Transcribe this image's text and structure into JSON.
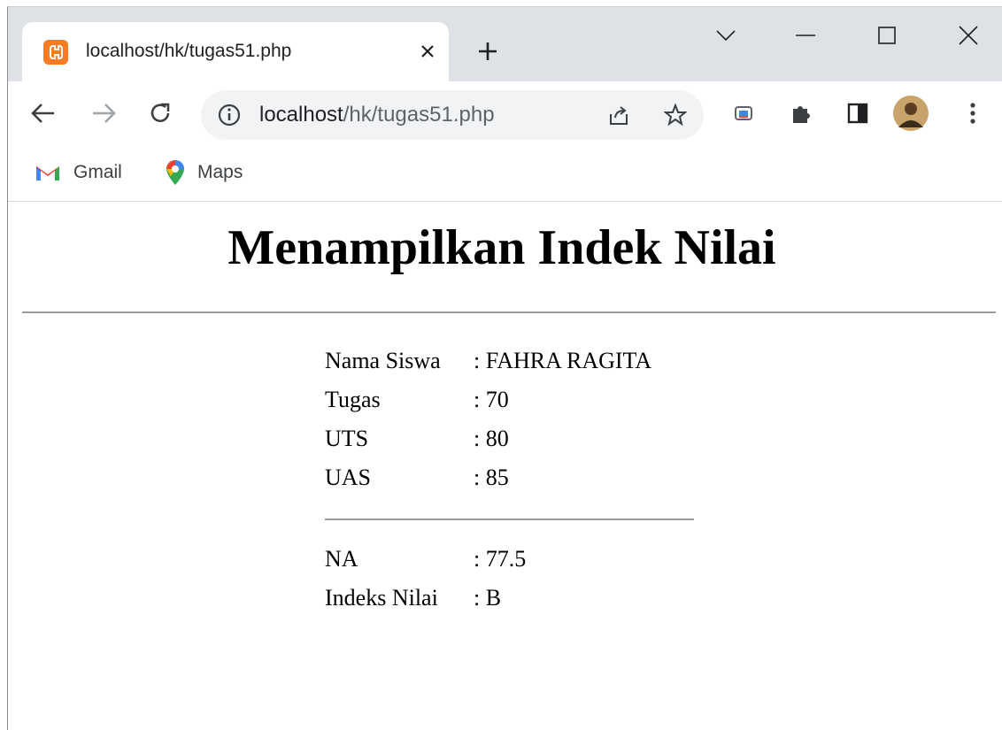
{
  "browser": {
    "tab": {
      "title": "localhost/hk/tugas51.php"
    },
    "address": {
      "host": "localhost",
      "path": "/hk/tugas51.php"
    },
    "bookmarks": [
      {
        "label": "Gmail"
      },
      {
        "label": "Maps"
      }
    ]
  },
  "page": {
    "heading": "Menampilkan Indek Nilai",
    "rows": [
      {
        "label": "Nama Siswa",
        "value": ": FAHRA RAGITA"
      },
      {
        "label": "Tugas",
        "value": ": 70"
      },
      {
        "label": "UTS",
        "value": ": 80"
      },
      {
        "label": "UAS",
        "value": ": 85"
      }
    ],
    "results": [
      {
        "label": "NA",
        "value": ": 77.5"
      },
      {
        "label": "Indeks Nilai",
        "value": ": B"
      }
    ]
  },
  "colors": {
    "tabstrip": "#dee1e6",
    "omnibox": "#f1f3f4",
    "favicon": "#fb7a24"
  }
}
